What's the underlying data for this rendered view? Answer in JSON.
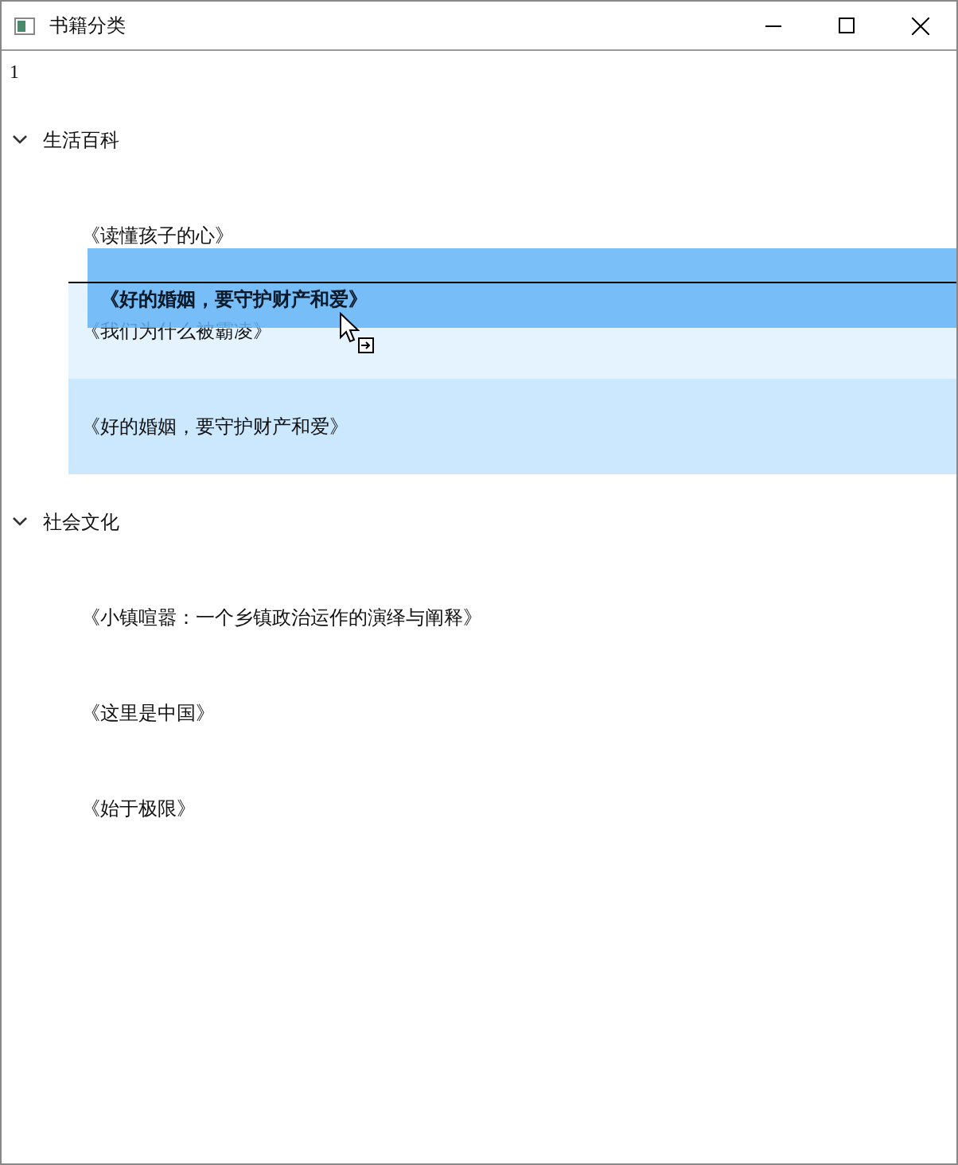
{
  "window": {
    "title": "书籍分类"
  },
  "header": "1",
  "tree": [
    {
      "label": "生活百科",
      "expanded": true,
      "children": [
        {
          "label": "《读懂孩子的心》",
          "hovered": false,
          "selected": false
        },
        {
          "label": "《我们为什么被霸凌》",
          "hovered": true,
          "selected": false
        },
        {
          "label": "《好的婚姻，要守护财产和爱》",
          "hovered": false,
          "selected": true
        }
      ]
    },
    {
      "label": "社会文化",
      "expanded": true,
      "children": [
        {
          "label": "《小镇喧嚣：一个乡镇政治运作的演绎与阐释》",
          "hovered": false,
          "selected": false
        },
        {
          "label": "《这里是中国》",
          "hovered": false,
          "selected": false
        },
        {
          "label": "《始于极限》",
          "hovered": false,
          "selected": false
        }
      ]
    }
  ],
  "drag": {
    "label": "《好的婚姻，要守护财产和爱》"
  }
}
